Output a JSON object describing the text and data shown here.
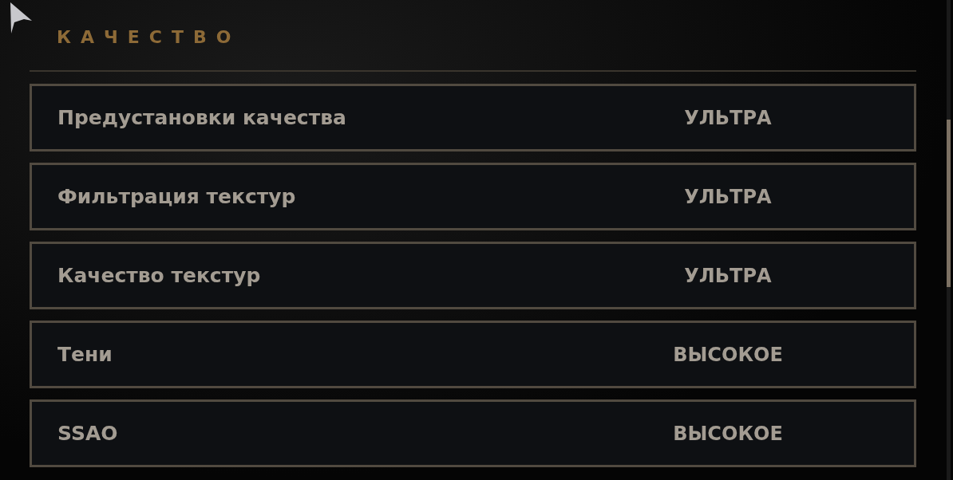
{
  "section": {
    "title": "КАЧЕСТВО"
  },
  "settings": [
    {
      "label": "Предустановки качества",
      "value": "УЛЬТРА"
    },
    {
      "label": "Фильтрация текстур",
      "value": "УЛЬТРА"
    },
    {
      "label": "Качество текстур",
      "value": "УЛЬТРА"
    },
    {
      "label": "Тени",
      "value": "ВЫСОКОЕ"
    },
    {
      "label": "SSAO",
      "value": "ВЫСОКОЕ"
    }
  ]
}
